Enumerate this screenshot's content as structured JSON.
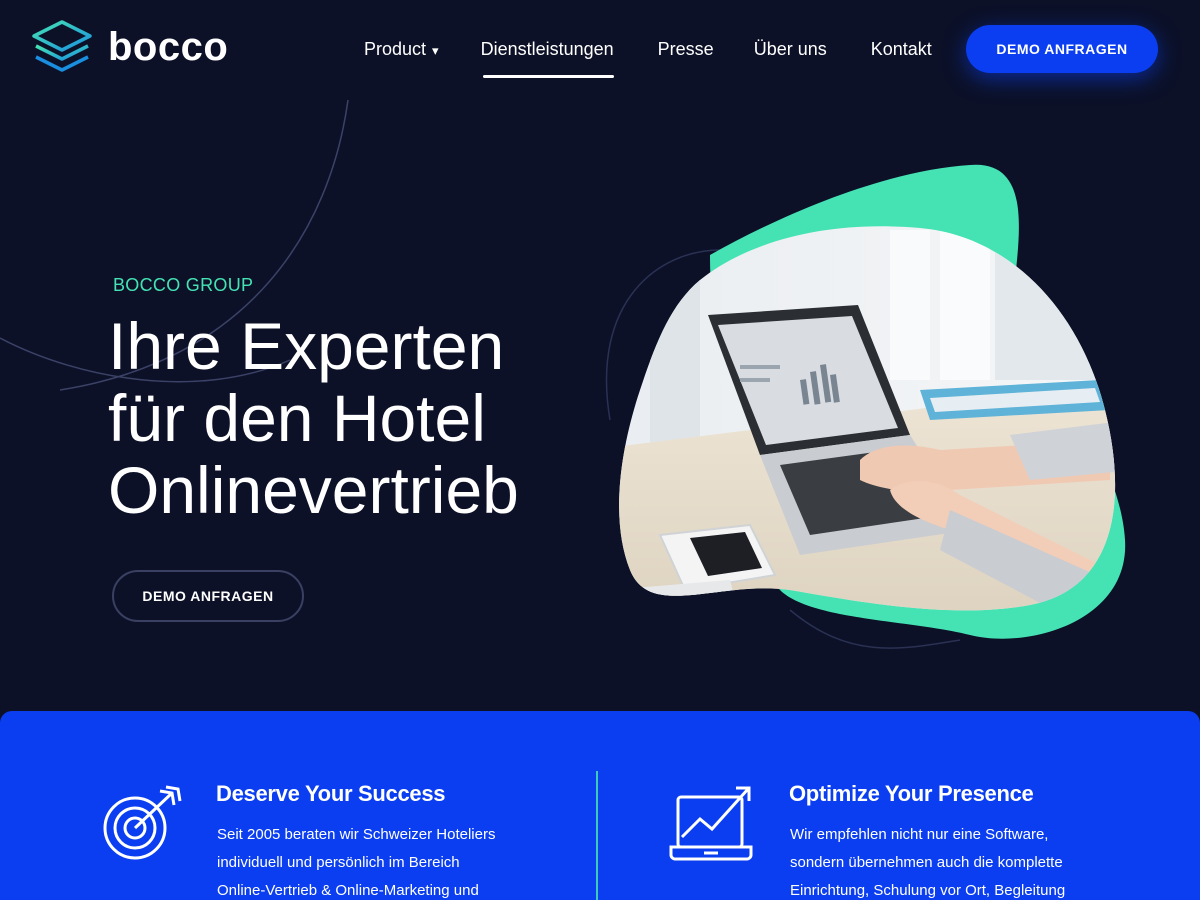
{
  "brand": {
    "name": "bocco"
  },
  "nav": {
    "items": [
      {
        "label": "Product",
        "has_dropdown": true,
        "active": false
      },
      {
        "label": "Dienstleistungen",
        "has_dropdown": false,
        "active": true
      },
      {
        "label": "Presse",
        "has_dropdown": false,
        "active": false
      },
      {
        "label": "Über uns",
        "has_dropdown": false,
        "active": false
      },
      {
        "label": "Kontakt",
        "has_dropdown": false,
        "active": false
      }
    ],
    "dropdown_caret": "▾",
    "cta_label": "DEMO ANFRAGEN"
  },
  "hero": {
    "eyebrow": "BOCCO GROUP",
    "headline_lines": [
      "Ihre Experten",
      "für den Hotel",
      "Onlinevertrieb"
    ],
    "cta_label": "DEMO ANFRAGEN",
    "image_icon": "laptop-workspace-illustration"
  },
  "features": [
    {
      "icon": "target-arrow-icon",
      "title": "Deserve Your Success",
      "text_lines": [
        "Seit 2005 beraten wir Schweizer Hoteliers",
        "individuell und persönlich im Bereich",
        "Online-Vertrieb & Online-Marketing und"
      ]
    },
    {
      "icon": "laptop-growth-chart-icon",
      "title": "Optimize Your Presence",
      "text_lines": [
        "Wir empfehlen nicht nur eine Software,",
        "sondern übernehmen auch die komplette",
        "Einrichtung, Schulung vor Ort, Begleitung"
      ]
    }
  ],
  "colors": {
    "background": "#0c1128",
    "accent_green": "#45e3b3",
    "brand_blue": "#0a3ef0",
    "white": "#ffffff"
  }
}
